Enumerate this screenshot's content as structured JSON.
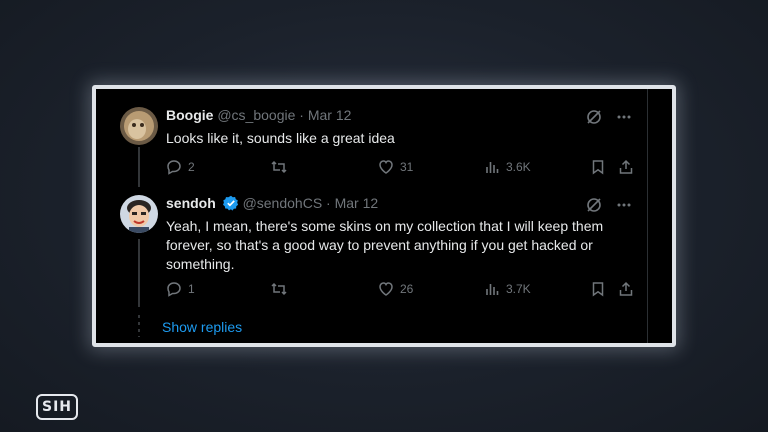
{
  "tweets": [
    {
      "display_name": "Boogie",
      "handle": "@cs_boogie",
      "date": "Mar 12",
      "text": "Looks like it, sounds like a great idea",
      "verified": false,
      "stats": {
        "replies": "2",
        "retweets": "",
        "likes": "31",
        "views": "3.6K"
      }
    },
    {
      "display_name": "sendoh",
      "handle": "@sendohCS",
      "date": "Mar 12",
      "text": "Yeah, I mean, there's some skins on my collection that I will keep them forever, so that's a good way to prevent anything if you get hacked or something.",
      "verified": true,
      "stats": {
        "replies": "1",
        "retweets": "",
        "likes": "26",
        "views": "3.7K"
      }
    }
  ],
  "show_replies_label": "Show replies",
  "separator": "·",
  "logo_text": "SIH",
  "colors": {
    "accent": "#1d9bf0",
    "muted": "#71767b",
    "text": "#e7e9ea",
    "background": "#000000"
  },
  "icons": [
    "grok-icon",
    "more-icon",
    "reply-icon",
    "retweet-icon",
    "like-icon",
    "views-icon",
    "bookmark-icon",
    "share-icon",
    "verified-icon"
  ]
}
